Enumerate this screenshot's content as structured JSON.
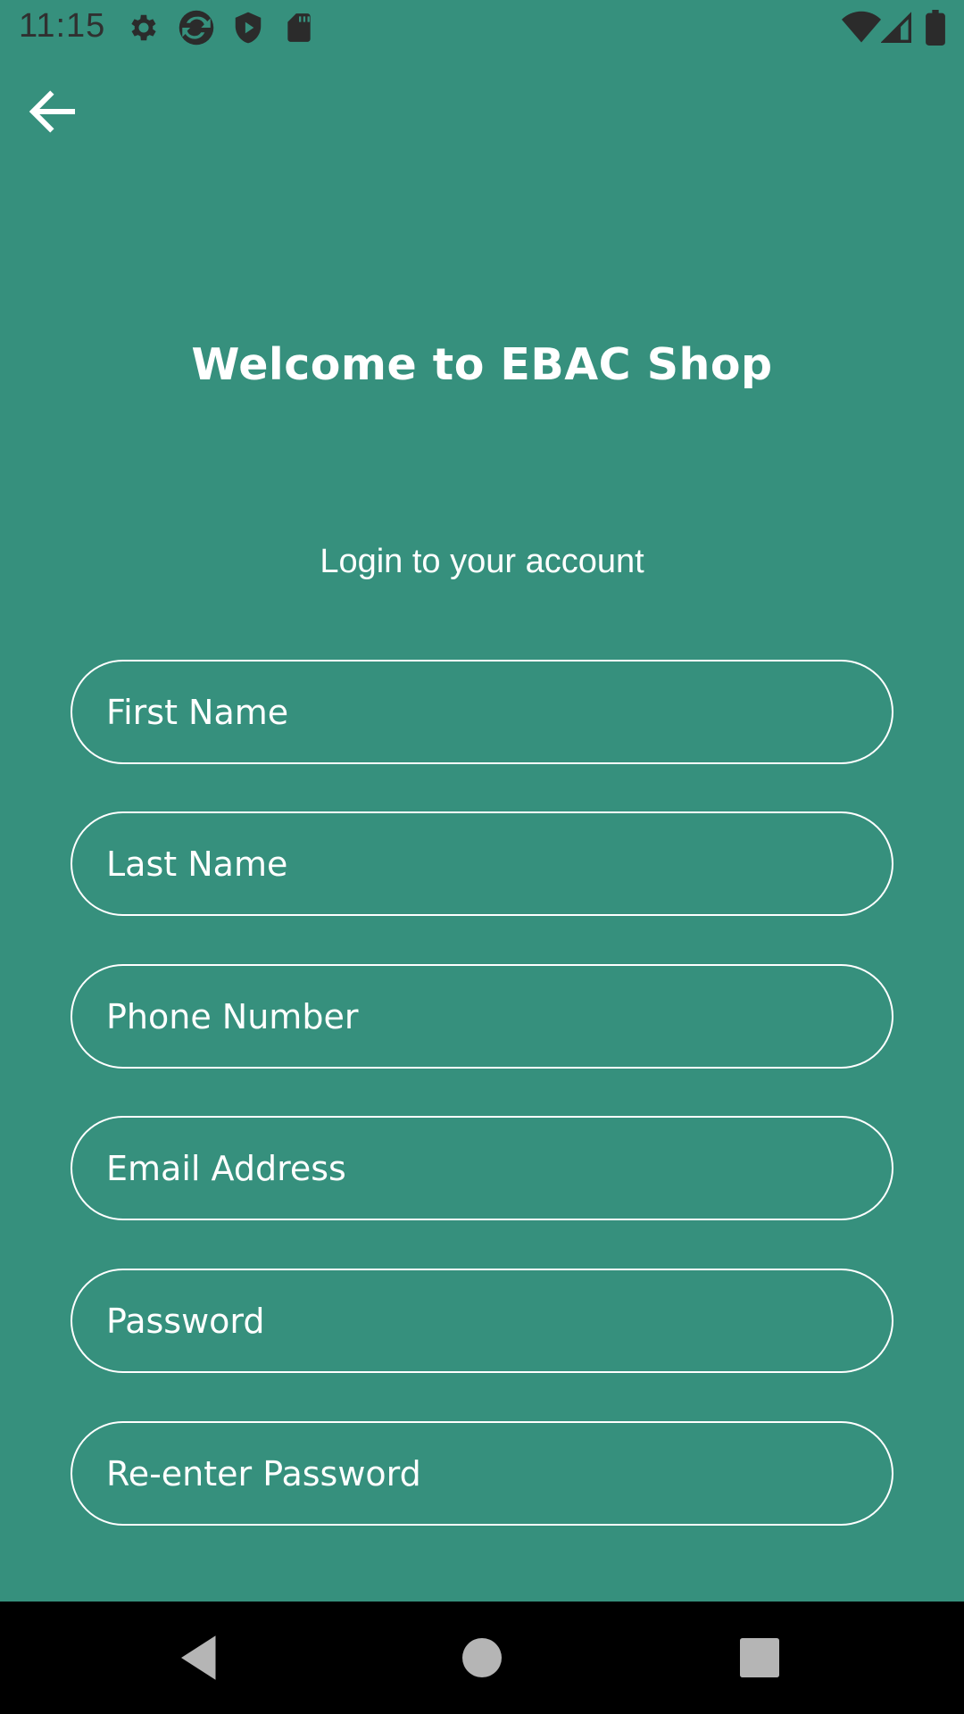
{
  "status_bar": {
    "time": "11:15",
    "icons": [
      "gear-icon",
      "sync-icon",
      "shield-icon",
      "sd-card-icon"
    ],
    "right_icons": [
      "wifi-icon",
      "signal-icon",
      "battery-icon"
    ]
  },
  "header": {
    "back_icon": "arrow-left-icon"
  },
  "main": {
    "title": "Welcome to EBAC Shop",
    "subtitle": "Login to your account"
  },
  "form": {
    "first_name": {
      "placeholder": "First Name",
      "value": ""
    },
    "last_name": {
      "placeholder": "Last Name",
      "value": ""
    },
    "phone": {
      "placeholder": "Phone Number",
      "value": ""
    },
    "email": {
      "placeholder": "Email Address",
      "value": ""
    },
    "password": {
      "placeholder": "Password",
      "value": ""
    },
    "password_confirm": {
      "placeholder": "Re-enter Password",
      "value": ""
    }
  },
  "nav_bar": {
    "buttons": [
      "back-triangle-icon",
      "home-circle-icon",
      "recents-square-icon"
    ]
  },
  "colors": {
    "background": "#36907d",
    "text": "#ffffff",
    "nav_bar": "#000000"
  }
}
